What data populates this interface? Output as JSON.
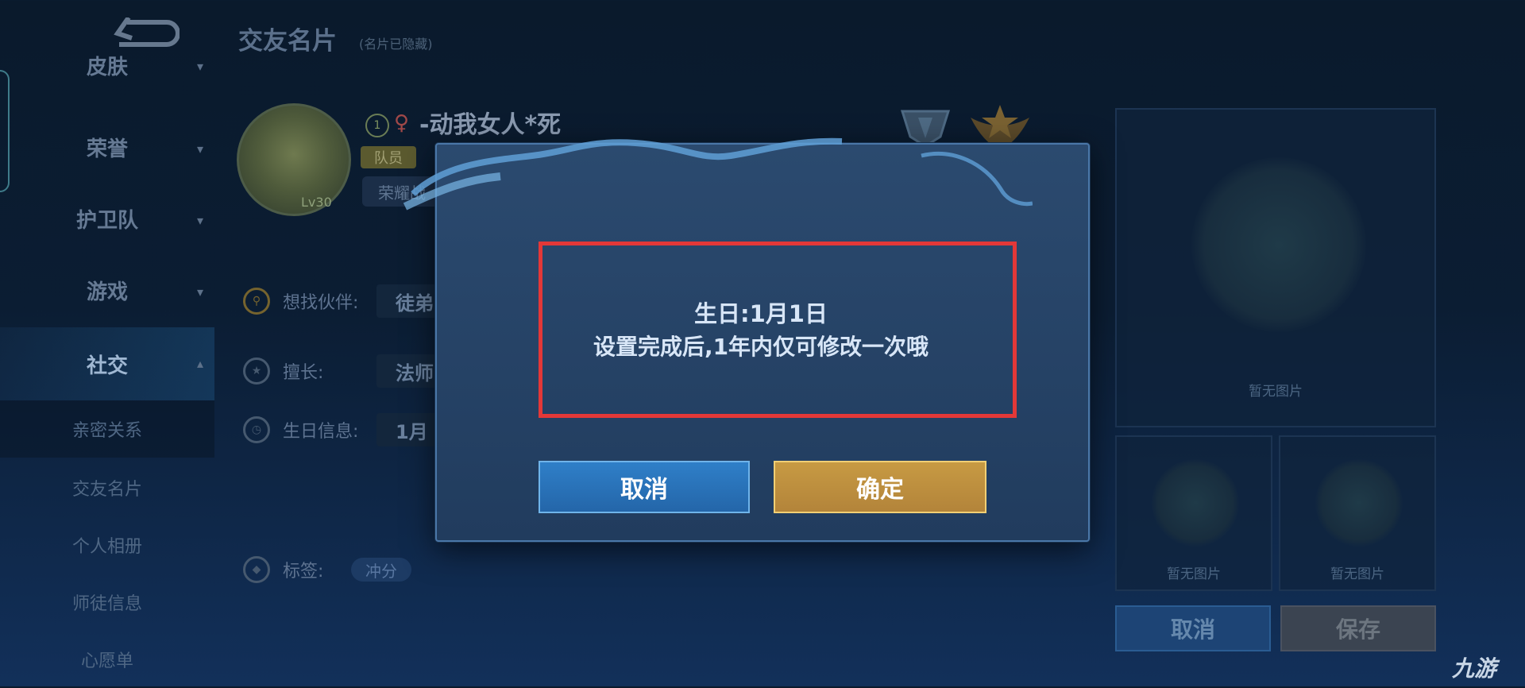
{
  "sidebar": {
    "items": [
      {
        "label": "皮肤"
      },
      {
        "label": "荣誉"
      },
      {
        "label": "护卫队"
      },
      {
        "label": "游戏"
      },
      {
        "label": "社交"
      }
    ],
    "subitems": [
      {
        "label": "亲密关系"
      },
      {
        "label": "交友名片"
      },
      {
        "label": "个人相册"
      },
      {
        "label": "师徒信息"
      },
      {
        "label": "心愿单"
      }
    ]
  },
  "header": {
    "title": "交友名片",
    "subtitle": "(名片已隐藏)"
  },
  "profile": {
    "rank_number": "1",
    "gender_symbol": "♀",
    "nickname": "-动我女人*死",
    "team_tag": "队员",
    "glory_tag": "荣耀战",
    "level": "Lv30"
  },
  "form": {
    "partner_label": "想找伙伴:",
    "partner_value": "徒弟",
    "specialty_label": "擅长:",
    "specialty_value": "法师",
    "birthday_label": "生日信息:",
    "birthday_value": "1月",
    "tags_label": "标签:",
    "tag_chip": "冲分"
  },
  "photos": {
    "empty_text": "暂无图片"
  },
  "page_buttons": {
    "cancel": "取消",
    "save": "保存"
  },
  "modal": {
    "line1": "生日:1月1日",
    "line2": "设置完成后,1年内仅可修改一次哦",
    "cancel_label": "取消",
    "confirm_label": "确定"
  },
  "watermark": "九游",
  "colors": {
    "highlight_border": "#e33838",
    "confirm": "#b98a3c",
    "cancel": "#2a73bb"
  }
}
